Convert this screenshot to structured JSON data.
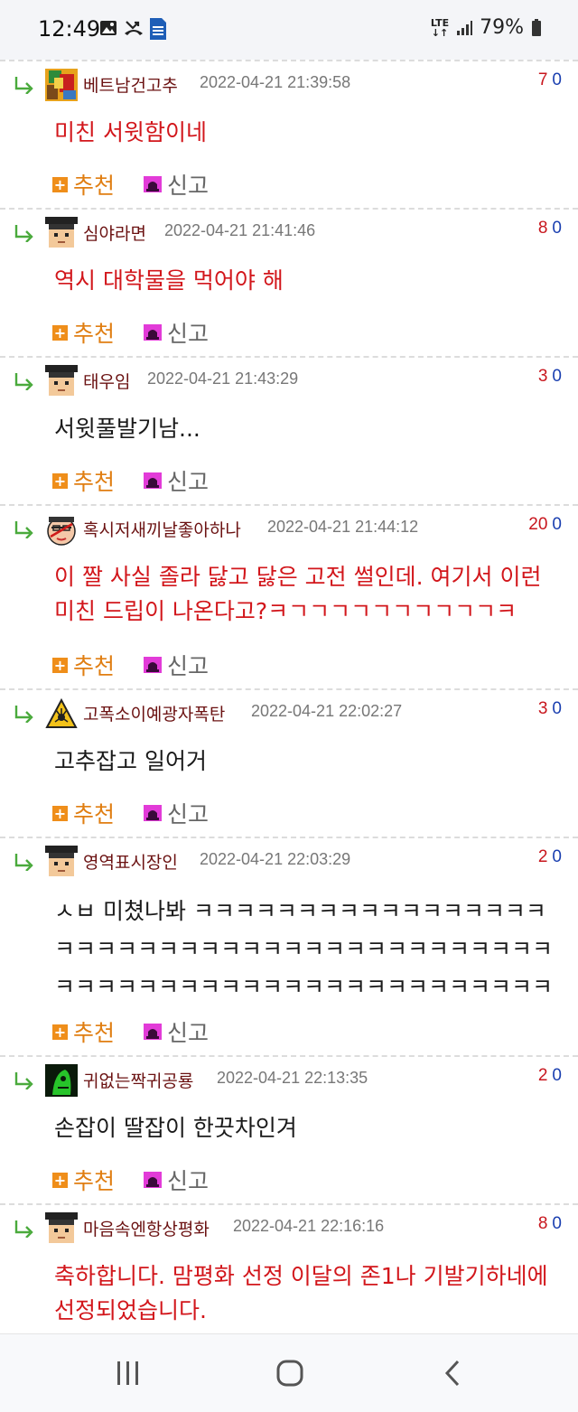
{
  "status_bar": {
    "time": "12:49",
    "network": "LTE",
    "battery": "79%"
  },
  "labels": {
    "recommend": "추천",
    "report": "신고"
  },
  "comments": [
    {
      "nick": "베트남건고추",
      "date": "2022-04-21 21:39:58",
      "up": "7",
      "down": "0",
      "text": "미친 서윗함이네",
      "text_color": "red",
      "avatar": "pixel-art"
    },
    {
      "nick": "심야라면",
      "date": "2022-04-21 21:41:46",
      "up": "8",
      "down": "0",
      "text": "역시 대학물을 먹어야 해",
      "text_color": "red",
      "avatar": "grad-cap"
    },
    {
      "nick": "태우임",
      "date": "2022-04-21 21:43:29",
      "up": "3",
      "down": "0",
      "text": "서윗풀발기남...",
      "text_color": "black",
      "avatar": "grad-cap"
    },
    {
      "nick": "혹시저새끼날좋아하나",
      "date": "2022-04-21 21:44:12",
      "up": "20",
      "down": "0",
      "text": "이 짤 사실 졸라 닳고 닳은 고전 썰인데. 여기서 이런 미친 드립이 나온다고?ㅋㄱㄱㄱㄱㄱㄱㄱㄱㄱㄱㅋ",
      "text_color": "red",
      "avatar": "face"
    },
    {
      "nick": "고폭소이예광자폭탄",
      "date": "2022-04-21 22:02:27",
      "up": "3",
      "down": "0",
      "text": "고추잡고 일어거",
      "text_color": "black",
      "avatar": "warning"
    },
    {
      "nick": "영역표시장인",
      "date": "2022-04-21 22:03:29",
      "up": "2",
      "down": "0",
      "text": "ㅅㅂ 미쳤나봐 ㅋㅋㅋㅋㅋㅋㅋㅋㅋㅋㅋㅋㅋㅋㅋㅋㅋㅋㅋㅋㅋㅋㅋㅋㅋㅋㅋㅋㅋㅋㅋㅋㅋㅋㅋㅋㅋㅋㅋㅋㅋㅋㅋㅋㅋㅋㅋㅋㅋㅋㅋㅋㅋㅋㅋㅋㅋㅋㅋㅋㅋㅋㅋㅋㅋㅋㅋㅋ",
      "text_color": "black",
      "avatar": "grad-cap"
    },
    {
      "nick": "귀없는짝귀공룡",
      "date": "2022-04-21 22:13:35",
      "up": "2",
      "down": "0",
      "text": "손잡이 딸잡이 한끗차인겨",
      "text_color": "black",
      "avatar": "green"
    },
    {
      "nick": "마음속엔항상평화",
      "date": "2022-04-21 22:16:16",
      "up": "8",
      "down": "0",
      "text": "축하합니다. 맘평화 선정 이달의 존1나 기발기하네에 선정되었습니다.",
      "text_color": "red",
      "avatar": "grad-cap"
    }
  ]
}
